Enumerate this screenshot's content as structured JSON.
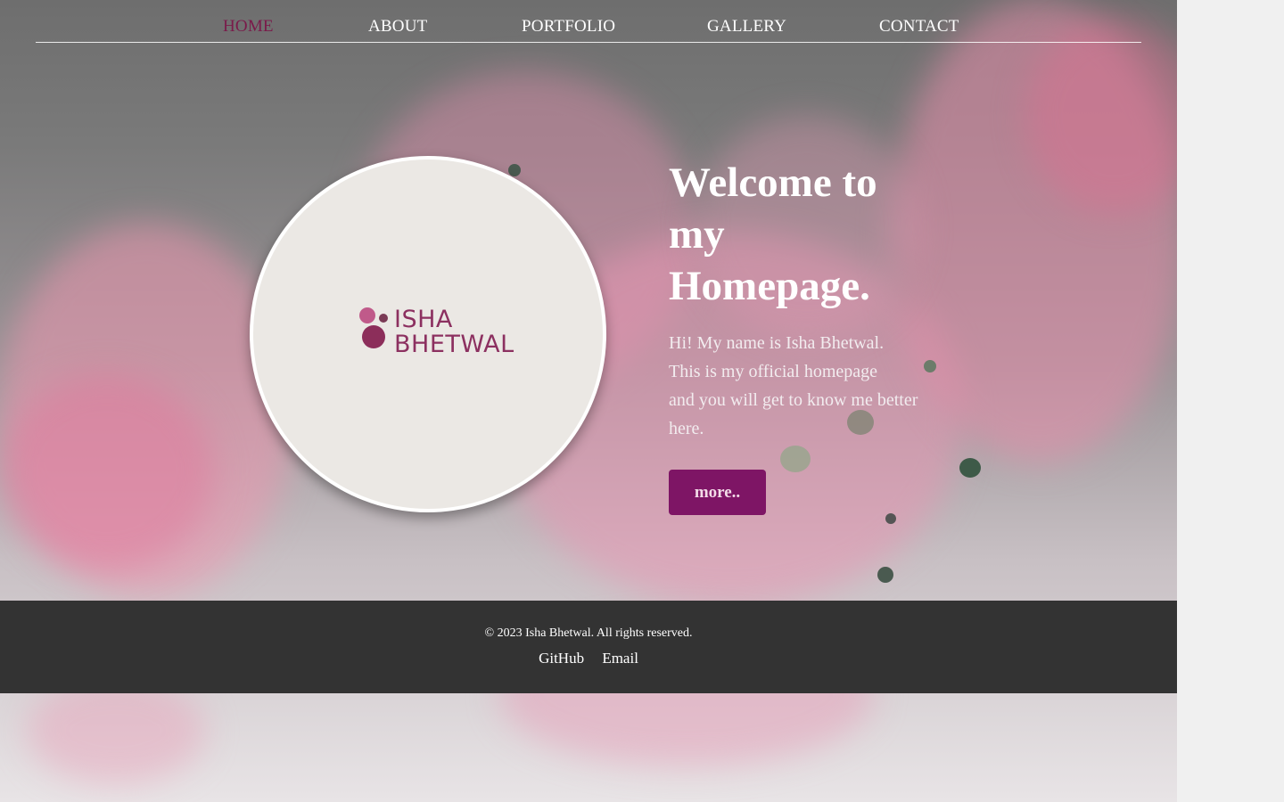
{
  "nav": {
    "items": [
      {
        "label": "HOME",
        "active": true
      },
      {
        "label": "ABOUT",
        "active": false
      },
      {
        "label": "PORTFOLIO",
        "active": false
      },
      {
        "label": "GALLERY",
        "active": false
      },
      {
        "label": "CONTACT",
        "active": false
      }
    ]
  },
  "hero": {
    "logo": {
      "line1": "ISHA",
      "line2": "BHETWAL"
    },
    "title_lines": [
      "Welcome to",
      "my",
      "Homepage."
    ],
    "intro_lines": [
      "Hi! My name is Isha Bhetwal.",
      "This is my official homepage",
      "and you will get to know me better",
      "here."
    ],
    "button_label": "more.."
  },
  "footer": {
    "copyright": "© 2023 Isha Bhetwal. All rights reserved.",
    "links": [
      "GitHub",
      "Email"
    ]
  },
  "colors": {
    "active_nav": "#7a1a4a",
    "button_bg": "#7e1565",
    "logo": "#8c3060",
    "footer_bg": "#333333"
  }
}
